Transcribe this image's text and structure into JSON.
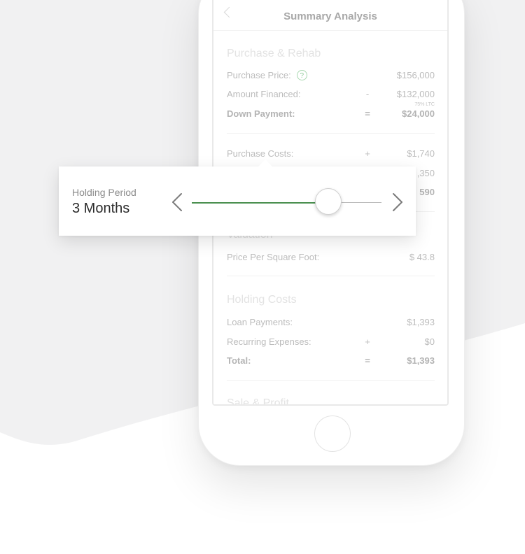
{
  "nav": {
    "title": "Summary Analysis"
  },
  "purchase_rehab": {
    "title": "Purchase & Rehab",
    "purchase_price": {
      "label": "Purchase Price:",
      "value": "$156,000"
    },
    "amount_financed": {
      "label": "Amount Financed:",
      "op": "-",
      "value": "$132,000",
      "note": "75% LTC"
    },
    "down_payment": {
      "label": "Down Payment:",
      "op": "=",
      "value": "$24,000"
    },
    "purchase_costs": {
      "label": "Purchase Costs:",
      "op": "+",
      "value": "$1,740"
    },
    "partial_value_1": ",350",
    "partial_value_2": "590"
  },
  "valuation": {
    "title": "Valuation",
    "price_per_sqft": {
      "label": "Price Per Square Foot:",
      "value": "$ 43.8"
    }
  },
  "holding_costs": {
    "title": "Holding Costs",
    "loan_payments": {
      "label": "Loan Payments:",
      "value": "$1,393"
    },
    "recurring_expenses": {
      "label": "Recurring Expenses:",
      "op": "+",
      "value": "$0"
    },
    "total": {
      "label": "Total:",
      "op": "=",
      "value": "$1,393"
    }
  },
  "sale_profit": {
    "title": "Sale & Profit"
  },
  "holding_period": {
    "label": "Holding Period",
    "value": "3 Months",
    "slider_fraction": 0.72
  },
  "icons": {
    "help": "?",
    "accent_color": "#4a8f4f"
  }
}
